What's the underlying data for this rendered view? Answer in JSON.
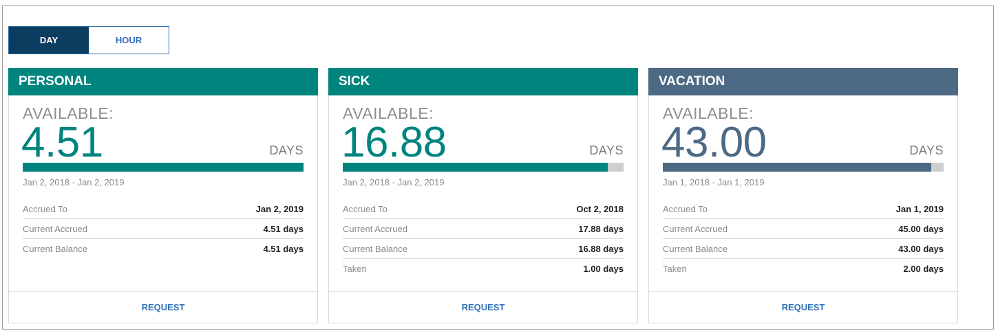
{
  "toggle": {
    "day_label": "DAY",
    "hour_label": "HOUR",
    "selected": "DAY"
  },
  "colors": {
    "teal": "#00847e",
    "slate": "#4d6a85",
    "toggle_active": "#0d3c61",
    "link": "#2e72b8"
  },
  "cards": [
    {
      "title": "PERSONAL",
      "available_label": "AVAILABLE:",
      "amount": "4.51",
      "unit": "DAYS",
      "progress": 1.0,
      "date_range": "Jan 2, 2018 - Jan 2, 2019",
      "details": [
        {
          "label": "Accrued To",
          "value": "Jan 2, 2019"
        },
        {
          "label": "Current Accrued",
          "value": "4.51 days"
        },
        {
          "label": "Current Balance",
          "value": "4.51 days"
        }
      ],
      "request_label": "REQUEST"
    },
    {
      "title": "SICK",
      "available_label": "AVAILABLE:",
      "amount": "16.88",
      "unit": "DAYS",
      "progress": 0.944,
      "date_range": "Jan 2, 2018 - Jan 2, 2019",
      "details": [
        {
          "label": "Accrued To",
          "value": "Oct 2, 2018"
        },
        {
          "label": "Current Accrued",
          "value": "17.88 days"
        },
        {
          "label": "Current Balance",
          "value": "16.88 days"
        },
        {
          "label": "Taken",
          "value": "1.00 days"
        }
      ],
      "request_label": "REQUEST"
    },
    {
      "title": "VACATION",
      "available_label": "AVAILABLE:",
      "amount": "43.00",
      "unit": "DAYS",
      "progress": 0.956,
      "date_range": "Jan 1, 2018 - Jan 1, 2019",
      "details": [
        {
          "label": "Accrued To",
          "value": "Jan 1, 2019"
        },
        {
          "label": "Current Accrued",
          "value": "45.00 days"
        },
        {
          "label": "Current Balance",
          "value": "43.00 days"
        },
        {
          "label": "Taken",
          "value": "2.00 days"
        }
      ],
      "request_label": "REQUEST"
    }
  ]
}
